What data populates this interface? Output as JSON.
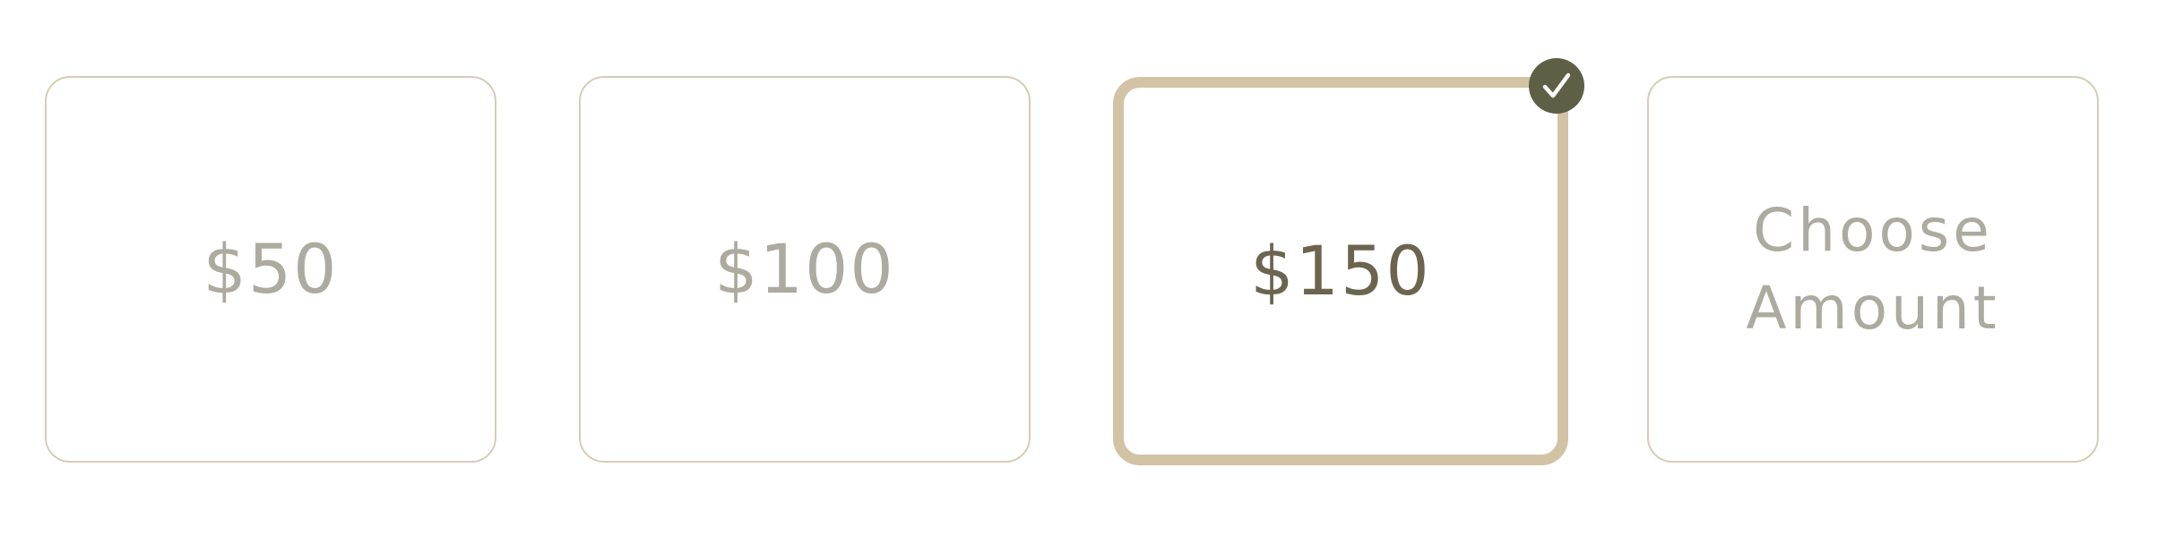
{
  "donation_options": [
    {
      "label": "$50",
      "selected": false
    },
    {
      "label": "$100",
      "selected": false
    },
    {
      "label": "$150",
      "selected": true
    },
    {
      "label": "Choose Amount",
      "line1": "Choose",
      "line2": "Amount",
      "selected": false
    }
  ],
  "colors": {
    "card_border": "#d8cbb6",
    "selected_border": "#d3c3a5",
    "label_text": "#adaa9f",
    "selected_text": "#6b6550",
    "check_badge": "#5e5f45"
  },
  "icons": {
    "selected_indicator": "check-icon"
  }
}
